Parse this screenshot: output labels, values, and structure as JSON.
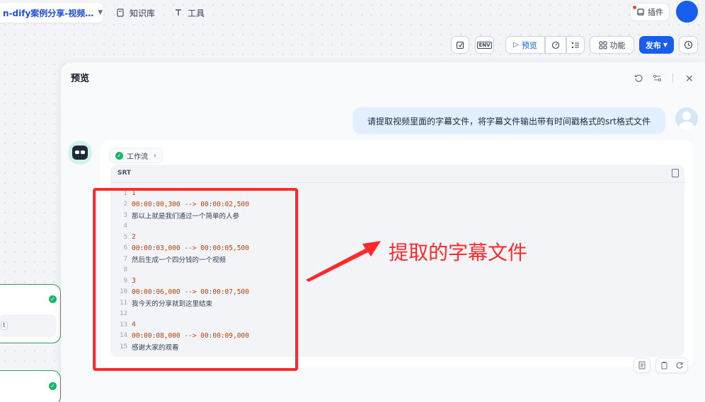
{
  "topbar": {
    "app_title": "n-dify案例分享-视频…",
    "nav": [
      {
        "label": "知识库",
        "icon": "book-icon"
      },
      {
        "label": "工具",
        "icon": "tool-icon"
      }
    ],
    "plugin_label": "插件"
  },
  "toolbar": {
    "env_label": "ENV",
    "preview_label": "预览",
    "features_label": "功能",
    "publish_label": "发布"
  },
  "preview": {
    "title": "预览",
    "user_message": "请提取视频里面的字幕文件，将字幕文件输出带有时间戳格式的srt格式文件",
    "workflow_tag": "工作流",
    "code_lang": "SRT",
    "lines": [
      {
        "n": "1",
        "text": "1",
        "kind": "num"
      },
      {
        "n": "2",
        "text": "00:00:00,300 --> 00:00:02,500",
        "kind": "ts"
      },
      {
        "n": "3",
        "text": "那以上就是我们通过一个简单的人参",
        "kind": "text"
      },
      {
        "n": "4",
        "text": "",
        "kind": "text"
      },
      {
        "n": "5",
        "text": "2",
        "kind": "num"
      },
      {
        "n": "6",
        "text": "00:00:03,000 --> 00:00:05,500",
        "kind": "ts"
      },
      {
        "n": "7",
        "text": "然后生成一个四分钱的一个视频",
        "kind": "text"
      },
      {
        "n": "8",
        "text": "",
        "kind": "text"
      },
      {
        "n": "9",
        "text": "3",
        "kind": "num"
      },
      {
        "n": "10",
        "text": "00:00:06,000 --> 00:00:07,500",
        "kind": "ts"
      },
      {
        "n": "11",
        "text": "我今天的分享就到这里结束",
        "kind": "text"
      },
      {
        "n": "12",
        "text": "",
        "kind": "text"
      },
      {
        "n": "13",
        "text": "4",
        "kind": "num"
      },
      {
        "n": "14",
        "text": "00:00:08,000 --> 00:00:09,000",
        "kind": "ts"
      },
      {
        "n": "15",
        "text": "感谢大家的观看",
        "kind": "text"
      }
    ]
  },
  "annotation": {
    "label": "提取的字幕文件",
    "color": "#ff2b2b"
  },
  "left_nodes": {
    "fragment_label": "t"
  },
  "colors": {
    "primary": "#155eef",
    "success": "#12b76a"
  }
}
